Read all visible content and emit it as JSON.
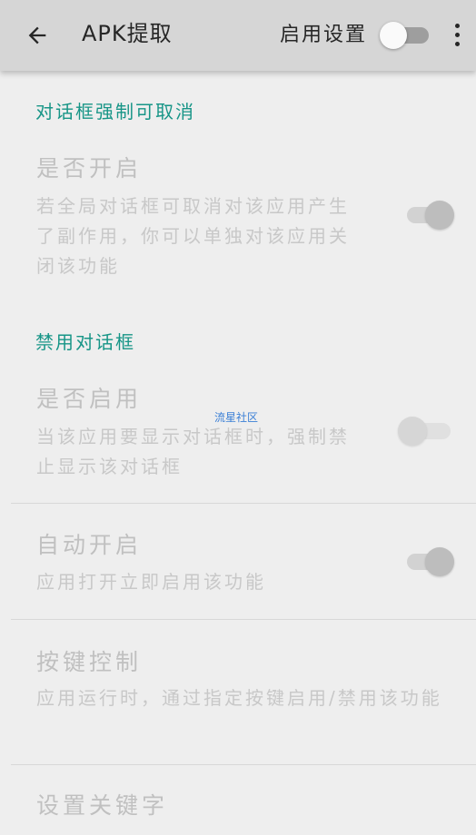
{
  "toolbar": {
    "title": "APK提取",
    "enable_label": "启用设置",
    "enable_switch_on": false,
    "back_icon": "arrow-left-icon",
    "more_icon": "more-vert-icon"
  },
  "sections": {
    "cancelable": {
      "header": "对话框强制可取消",
      "title": "是否开启",
      "summary": "若全局对话框可取消对该应用产生了副作用，你可以单独对该应用关闭该功能",
      "switch_on": true
    },
    "disable_dialog": {
      "header": "禁用对话框",
      "title": "是否启用",
      "summary": "当该应用要显示对话框时，强制禁止显示该对话框",
      "switch_on": false
    }
  },
  "auto_start": {
    "title": "自动开启",
    "summary": "应用打开立即启用该功能",
    "switch_on": true
  },
  "key_control": {
    "title": "按键控制",
    "summary": "应用运行时，通过指定按键启用/禁用该功能"
  },
  "keywords": {
    "title": "设置关键字"
  },
  "watermark": "流星社区",
  "colors": {
    "accent": "#179587",
    "toolbar_bg": "#d6d6d6",
    "page_bg": "#eeeeee"
  }
}
